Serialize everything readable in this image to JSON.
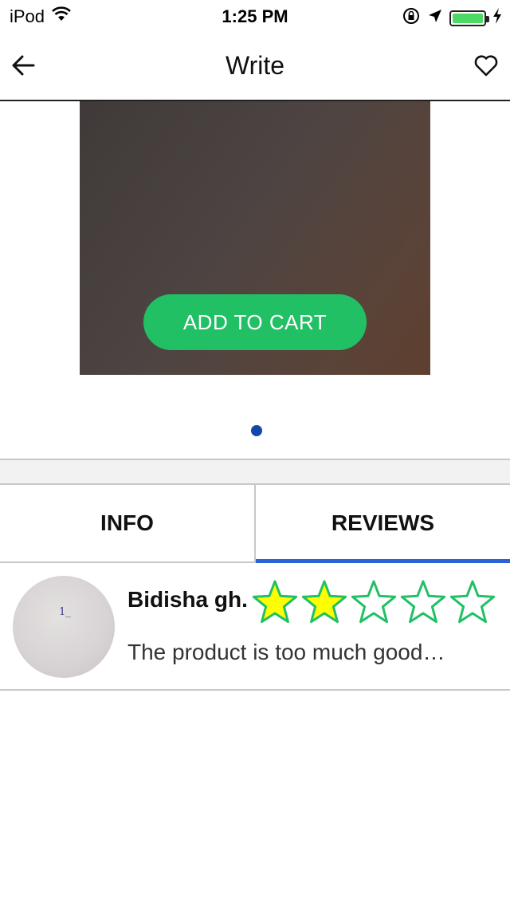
{
  "status_bar": {
    "carrier": "iPod",
    "time": "1:25 PM",
    "battery_level": 1.0
  },
  "nav": {
    "title": "Write",
    "back_icon": "arrow-left-icon",
    "favorite_icon": "heart-icon"
  },
  "product": {
    "add_to_cart_label": "ADD TO CART",
    "page_count": 1,
    "current_page": 1
  },
  "tabs": [
    {
      "label": "INFO",
      "active": false
    },
    {
      "label": "REVIEWS",
      "active": true
    }
  ],
  "reviews": [
    {
      "name": "Bidisha gh.",
      "rating": 2,
      "max_rating": 5,
      "text": "The product is too much good…",
      "avatar_mark": "1_"
    }
  ],
  "colors": {
    "accent_green": "#22c065",
    "tab_indicator": "#2a63d8",
    "page_dot": "#1249a8",
    "star_fill": "#ffff00",
    "star_stroke": "#22c065"
  }
}
